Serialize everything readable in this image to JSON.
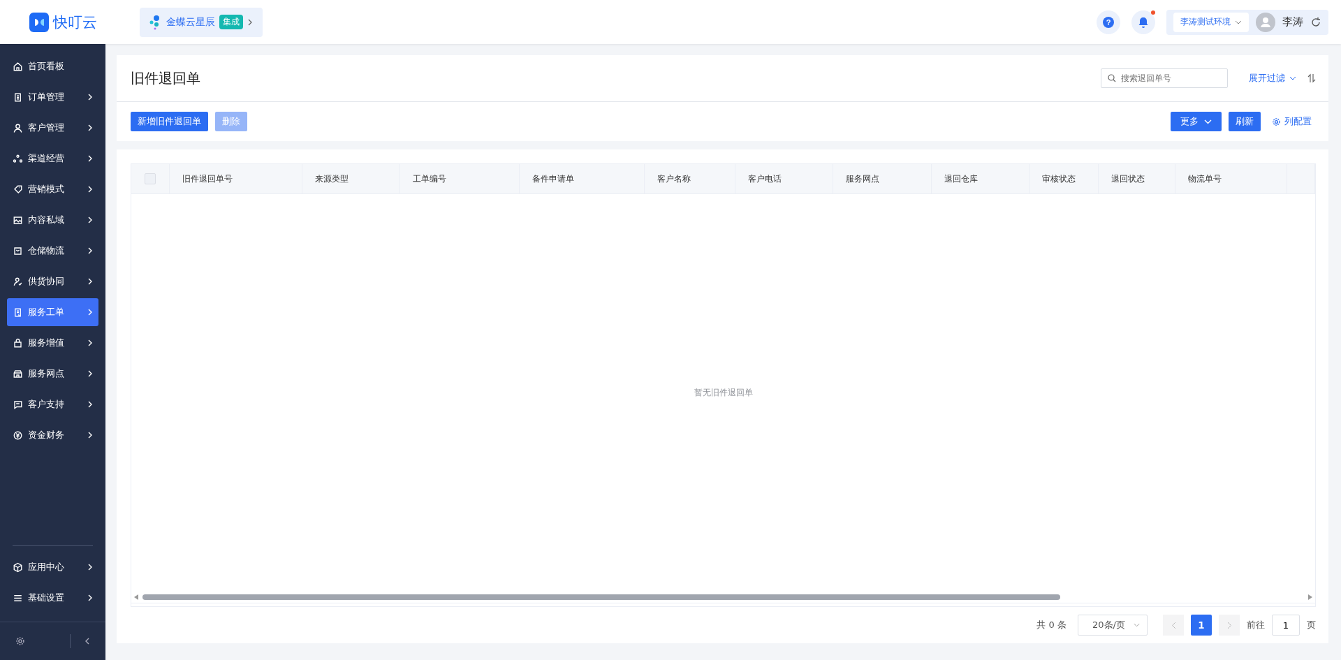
{
  "logo": "快叮云",
  "integration": {
    "name": "金蝶云星辰",
    "badge": "集成"
  },
  "header": {
    "help": "?",
    "notifications_unread": true,
    "environment": "李涛测试环境",
    "user": "李涛"
  },
  "sidebar": {
    "items": [
      {
        "label": "首页看板",
        "expandable": false,
        "selected": false
      },
      {
        "label": "订单管理",
        "expandable": true,
        "selected": false
      },
      {
        "label": "客户管理",
        "expandable": true,
        "selected": false
      },
      {
        "label": "渠道经营",
        "expandable": true,
        "selected": false
      },
      {
        "label": "营销模式",
        "expandable": true,
        "selected": false
      },
      {
        "label": "内容私域",
        "expandable": true,
        "selected": false
      },
      {
        "label": "仓储物流",
        "expandable": true,
        "selected": false
      },
      {
        "label": "供货协同",
        "expandable": true,
        "selected": false
      },
      {
        "label": "服务工单",
        "expandable": true,
        "selected": true
      },
      {
        "label": "服务增值",
        "expandable": true,
        "selected": false
      },
      {
        "label": "服务网点",
        "expandable": true,
        "selected": false
      },
      {
        "label": "客户支持",
        "expandable": true,
        "selected": false
      },
      {
        "label": "资金财务",
        "expandable": true,
        "selected": false
      }
    ],
    "bottom_items": [
      {
        "label": "应用中心",
        "expandable": true,
        "selected": false
      },
      {
        "label": "基础设置",
        "expandable": true,
        "selected": false
      }
    ]
  },
  "page": {
    "title": "旧件退回单",
    "search": {
      "placeholder": "搜索退回单号"
    },
    "filter": "展开过滤"
  },
  "toolbar": {
    "left": [
      {
        "label": "新增旧件退回单",
        "disabled": false
      },
      {
        "label": "删除",
        "disabled": true
      }
    ],
    "more": "更多",
    "refresh": "刷新",
    "columns_config": "列配置"
  },
  "table": {
    "select_all_checked": false,
    "columns": [
      "旧件退回单号",
      "来源类型",
      "工单编号",
      "备件申请单",
      "客户名称",
      "客户电话",
      "服务网点",
      "退回仓库",
      "审核状态",
      "退回状态",
      "物流单号"
    ],
    "empty": "暂无旧件退回单"
  },
  "pagination": {
    "total": "共 0 条",
    "page_size": "20条/页",
    "pages": [
      {
        "label": "1",
        "selected": true
      }
    ],
    "goto": "前往",
    "goto_value": "1",
    "goto_unit": "页"
  }
}
